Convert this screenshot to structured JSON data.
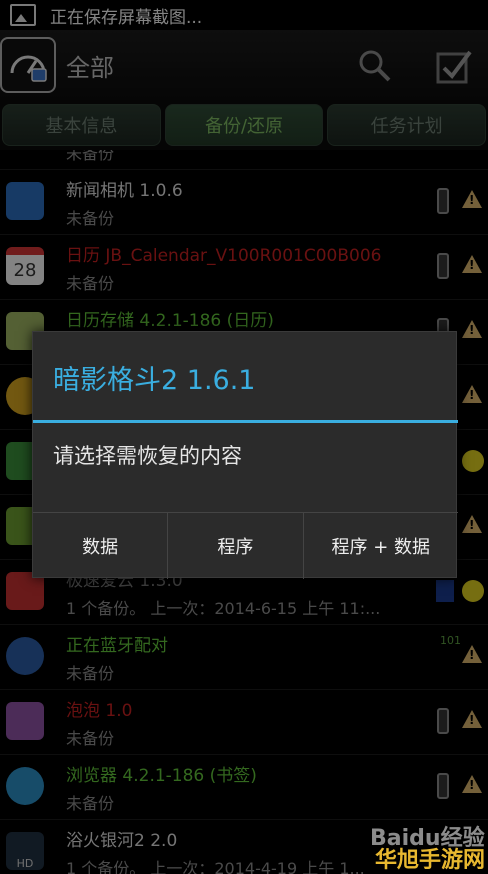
{
  "status_bar": {
    "text": "正在保存屏幕截图..."
  },
  "action_bar": {
    "title": "全部"
  },
  "tabs": [
    {
      "label": "基本信息",
      "active": false
    },
    {
      "label": "备份/还原",
      "active": true
    },
    {
      "label": "任务计划",
      "active": false
    }
  ],
  "list": {
    "partial_top": {
      "sub": "未备份"
    },
    "items": [
      {
        "name": "新闻相机 1.0.6",
        "sub": "未备份",
        "name_color": "#d6d6d6",
        "icon": "camera-icon"
      },
      {
        "name": "日历 JB_Calendar_V100R001C00B006",
        "sub": "未备份",
        "name_color": "#c02020",
        "icon": "calendar-icon",
        "icon_text": "28"
      },
      {
        "name": "日历存储 4.2.1-186 (日历)",
        "sub": "",
        "name_color": "#5fbf3a",
        "icon": "calendar-storage-icon"
      },
      {
        "name": "",
        "sub": "",
        "icon": "clock-icon"
      },
      {
        "name": "",
        "sub": "",
        "icon": "map-icon"
      },
      {
        "name": "",
        "sub": "",
        "icon": "game-icon"
      },
      {
        "name": "极速爱云 1.3.0",
        "sub": "1 个备份。 上一次：2014-6-15 上午 11:...",
        "name_color": "#d6d6d6",
        "icon": "racing-icon"
      },
      {
        "name": "正在蓝牙配对",
        "sub": "未备份",
        "name_color": "#5fbf3a",
        "icon": "bluetooth-icon"
      },
      {
        "name": "泡泡 1.0",
        "sub": "未备份",
        "name_color": "#c02020",
        "icon": "bubble-icon"
      },
      {
        "name": "浏览器 4.2.1-186 (书签)",
        "sub": "未备份",
        "name_color": "#5fbf3a",
        "icon": "browser-icon"
      },
      {
        "name": "浴火银河2 2.0",
        "sub": "1 个备份。 上一次：2014-4-19 上午 1...",
        "name_color": "#d6d6d6",
        "icon": "galaxy-icon",
        "icon_text": "HD"
      }
    ],
    "side_text": "101"
  },
  "dialog": {
    "title": "暗影格斗2 1.6.1",
    "message": "请选择需恢复的内容",
    "buttons": [
      "数据",
      "程序",
      "程序 + 数据"
    ]
  },
  "watermark": {
    "line1": "Baidu经验",
    "line2": "华旭手游网"
  },
  "colors": {
    "accent": "#3aaee0",
    "active_tab": "#7ab55f",
    "warning": "#d4b06a"
  }
}
